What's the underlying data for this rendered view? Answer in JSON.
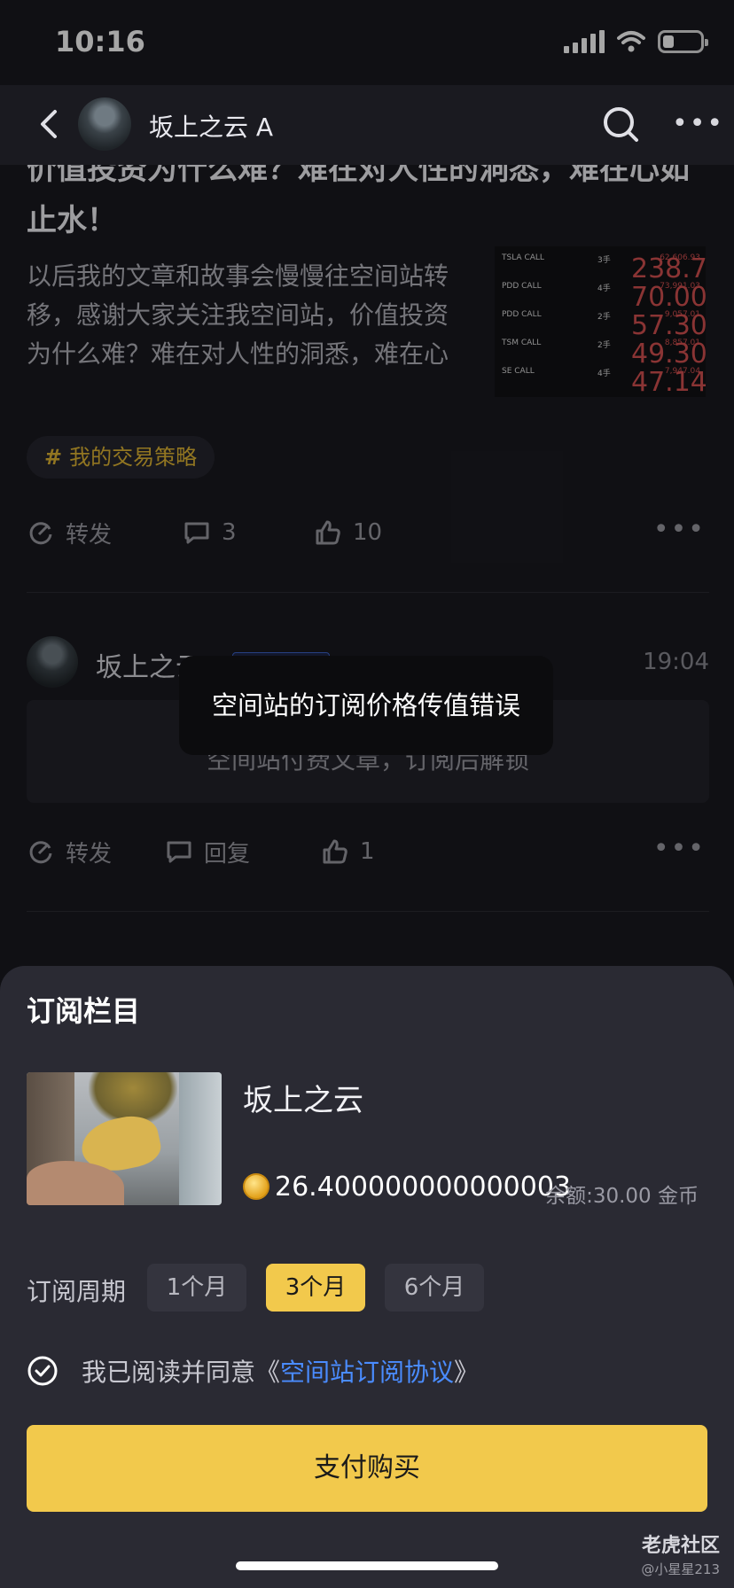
{
  "status_bar": {
    "time": "10:16"
  },
  "nav": {
    "title": "坂上之云 A"
  },
  "article": {
    "title": "价值投资为什么难？难在对人性的洞悉，难在心如止水！",
    "body": "以后我的文章和故事会慢慢往空间站转移，感谢大家关注我空间站，价值投资为什么难？难在对人性的洞悉，难在心",
    "thumbnail_rows": [
      {
        "symbol": "TSLA CALL",
        "qty": "3手",
        "price": "238.70",
        "value": "62,606.93"
      },
      {
        "symbol": "PDD CALL",
        "qty": "4手",
        "price": "70.00",
        "value": "73,991.03"
      },
      {
        "symbol": "PDD CALL",
        "qty": "2手",
        "price": "57.30",
        "value": "9,057.01"
      },
      {
        "symbol": "TSM CALL",
        "qty": "2手",
        "price": "49.30",
        "value": "8,857.01"
      },
      {
        "symbol": "SE CALL",
        "qty": "4手",
        "price": "47.14",
        "value": "7,947.04"
      }
    ],
    "tag": {
      "hash": "#",
      "label": "我的交易策略"
    },
    "actions": {
      "repost": "转发",
      "comments": "3",
      "likes": "10"
    }
  },
  "post2": {
    "author": "坂上之云 A",
    "time": "19:04",
    "locked_text": "空间站付费文章，订阅后解锁",
    "actions": {
      "repost": "转发",
      "reply": "回复",
      "likes": "1"
    }
  },
  "toast": {
    "message": "空间站的订阅价格传值错误"
  },
  "sheet": {
    "title": "订阅栏目",
    "product_name": "坂上之云",
    "price": "26.400000000000003",
    "balance": "余额:30.00 金币",
    "period_label": "订阅周期",
    "periods": [
      "1个月",
      "3个月",
      "6个月"
    ],
    "selected_period": "3个月",
    "agree_prefix": "我已阅读并同意《",
    "agree_link": "空间站订阅协议",
    "agree_suffix": "》",
    "pay_label": "支付购买"
  },
  "watermark": {
    "logo": "老虎社区",
    "user": "@小星星213"
  },
  "colors": {
    "accent": "#f2c94c",
    "link": "#4a8cff",
    "sheet_bg": "#2a2a33"
  }
}
